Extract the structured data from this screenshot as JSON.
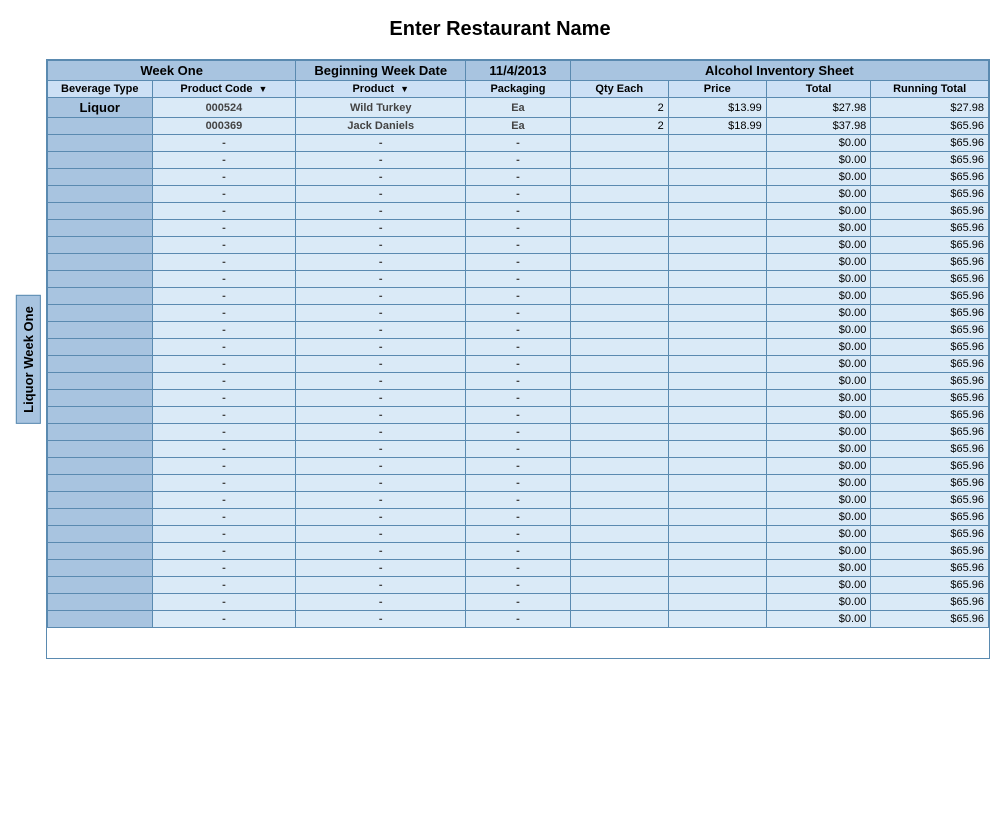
{
  "title": "Enter Restaurant Name",
  "header1": {
    "week_one": "Week One",
    "beginning_week_date": "Beginning Week Date",
    "date_value": "11/4/2013",
    "alcohol_inventory": "Alcohol Inventory Sheet"
  },
  "columns": {
    "beverage_type": "Beverage Type",
    "product_code": "Product Code",
    "product": "Product",
    "packaging": "Packaging",
    "qty_each": "Qty Each",
    "price": "Price",
    "total": "Total",
    "running_total": "Running Total"
  },
  "side_label": "Liquor Week One",
  "data_rows": [
    {
      "beverage_type": "Liquor",
      "code": "000524",
      "product": "Wild Turkey",
      "packaging": "Ea",
      "qty": "2",
      "price": "$13.99",
      "total": "$27.98",
      "running": "$27.98"
    },
    {
      "beverage_type": "",
      "code": "000369",
      "product": "Jack Daniels",
      "packaging": "Ea",
      "qty": "2",
      "price": "$18.99",
      "total": "$37.98",
      "running": "$65.96"
    },
    {
      "beverage_type": "",
      "code": "-",
      "product": "-",
      "packaging": "-",
      "qty": "",
      "price": "",
      "total": "$0.00",
      "running": "$65.96"
    },
    {
      "beverage_type": "",
      "code": "-",
      "product": "-",
      "packaging": "-",
      "qty": "",
      "price": "",
      "total": "$0.00",
      "running": "$65.96"
    },
    {
      "beverage_type": "",
      "code": "-",
      "product": "-",
      "packaging": "-",
      "qty": "",
      "price": "",
      "total": "$0.00",
      "running": "$65.96"
    },
    {
      "beverage_type": "",
      "code": "-",
      "product": "-",
      "packaging": "-",
      "qty": "",
      "price": "",
      "total": "$0.00",
      "running": "$65.96"
    },
    {
      "beverage_type": "",
      "code": "-",
      "product": "-",
      "packaging": "-",
      "qty": "",
      "price": "",
      "total": "$0.00",
      "running": "$65.96"
    },
    {
      "beverage_type": "",
      "code": "-",
      "product": "-",
      "packaging": "-",
      "qty": "",
      "price": "",
      "total": "$0.00",
      "running": "$65.96"
    },
    {
      "beverage_type": "",
      "code": "-",
      "product": "-",
      "packaging": "-",
      "qty": "",
      "price": "",
      "total": "$0.00",
      "running": "$65.96"
    },
    {
      "beverage_type": "",
      "code": "-",
      "product": "-",
      "packaging": "-",
      "qty": "",
      "price": "",
      "total": "$0.00",
      "running": "$65.96"
    },
    {
      "beverage_type": "",
      "code": "-",
      "product": "-",
      "packaging": "-",
      "qty": "",
      "price": "",
      "total": "$0.00",
      "running": "$65.96"
    },
    {
      "beverage_type": "",
      "code": "-",
      "product": "-",
      "packaging": "-",
      "qty": "",
      "price": "",
      "total": "$0.00",
      "running": "$65.96"
    },
    {
      "beverage_type": "",
      "code": "-",
      "product": "-",
      "packaging": "-",
      "qty": "",
      "price": "",
      "total": "$0.00",
      "running": "$65.96"
    },
    {
      "beverage_type": "",
      "code": "-",
      "product": "-",
      "packaging": "-",
      "qty": "",
      "price": "",
      "total": "$0.00",
      "running": "$65.96"
    },
    {
      "beverage_type": "",
      "code": "-",
      "product": "-",
      "packaging": "-",
      "qty": "",
      "price": "",
      "total": "$0.00",
      "running": "$65.96"
    },
    {
      "beverage_type": "",
      "code": "-",
      "product": "-",
      "packaging": "-",
      "qty": "",
      "price": "",
      "total": "$0.00",
      "running": "$65.96"
    },
    {
      "beverage_type": "",
      "code": "-",
      "product": "-",
      "packaging": "-",
      "qty": "",
      "price": "",
      "total": "$0.00",
      "running": "$65.96"
    },
    {
      "beverage_type": "",
      "code": "-",
      "product": "-",
      "packaging": "-",
      "qty": "",
      "price": "",
      "total": "$0.00",
      "running": "$65.96"
    },
    {
      "beverage_type": "",
      "code": "-",
      "product": "-",
      "packaging": "-",
      "qty": "",
      "price": "",
      "total": "$0.00",
      "running": "$65.96"
    },
    {
      "beverage_type": "",
      "code": "-",
      "product": "-",
      "packaging": "-",
      "qty": "",
      "price": "",
      "total": "$0.00",
      "running": "$65.96"
    },
    {
      "beverage_type": "",
      "code": "-",
      "product": "-",
      "packaging": "-",
      "qty": "",
      "price": "",
      "total": "$0.00",
      "running": "$65.96"
    },
    {
      "beverage_type": "",
      "code": "-",
      "product": "-",
      "packaging": "-",
      "qty": "",
      "price": "",
      "total": "$0.00",
      "running": "$65.96"
    },
    {
      "beverage_type": "",
      "code": "-",
      "product": "-",
      "packaging": "-",
      "qty": "",
      "price": "",
      "total": "$0.00",
      "running": "$65.96"
    },
    {
      "beverage_type": "",
      "code": "-",
      "product": "-",
      "packaging": "-",
      "qty": "",
      "price": "",
      "total": "$0.00",
      "running": "$65.96"
    },
    {
      "beverage_type": "",
      "code": "-",
      "product": "-",
      "packaging": "-",
      "qty": "",
      "price": "",
      "total": "$0.00",
      "running": "$65.96"
    },
    {
      "beverage_type": "",
      "code": "-",
      "product": "-",
      "packaging": "-",
      "qty": "",
      "price": "",
      "total": "$0.00",
      "running": "$65.96"
    },
    {
      "beverage_type": "",
      "code": "-",
      "product": "-",
      "packaging": "-",
      "qty": "",
      "price": "",
      "total": "$0.00",
      "running": "$65.96"
    },
    {
      "beverage_type": "",
      "code": "-",
      "product": "-",
      "packaging": "-",
      "qty": "",
      "price": "",
      "total": "$0.00",
      "running": "$65.96"
    },
    {
      "beverage_type": "",
      "code": "-",
      "product": "-",
      "packaging": "-",
      "qty": "",
      "price": "",
      "total": "$0.00",
      "running": "$65.96"
    },
    {
      "beverage_type": "",
      "code": "-",
      "product": "-",
      "packaging": "-",
      "qty": "",
      "price": "",
      "total": "$0.00",
      "running": "$65.96"
    },
    {
      "beverage_type": "",
      "code": "-",
      "product": "-",
      "packaging": "-",
      "qty": "",
      "price": "",
      "total": "$0.00",
      "running": "$65.96"
    }
  ]
}
